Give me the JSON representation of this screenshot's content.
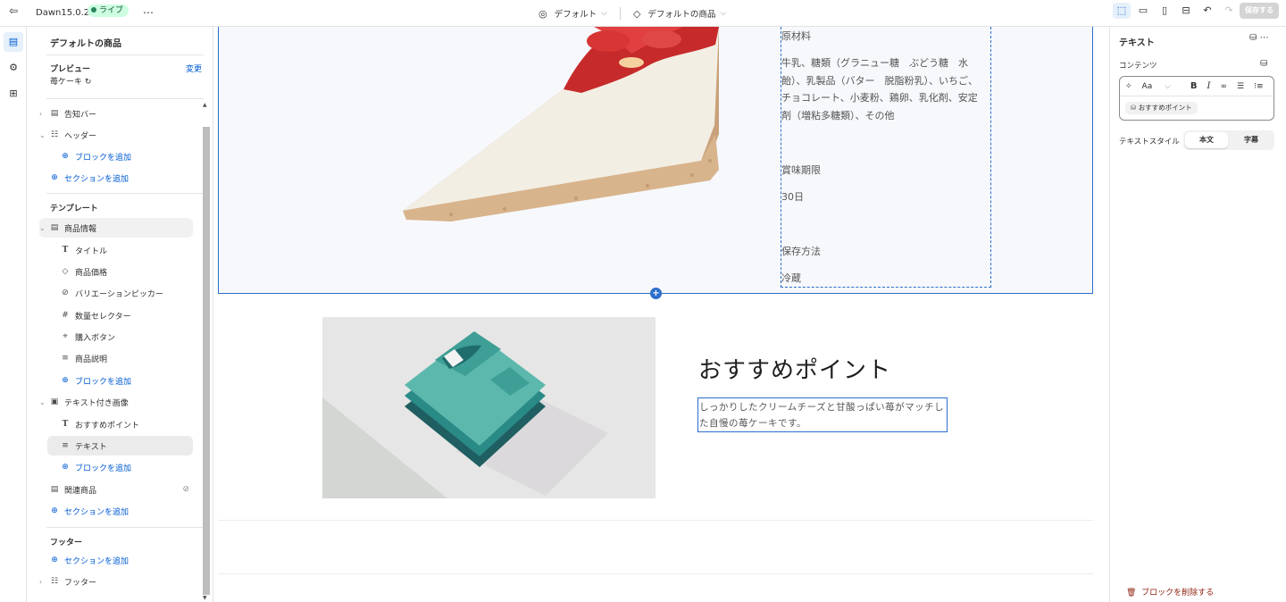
{
  "topbar": {
    "theme_name": "Dawn15.0.2",
    "live_badge": "ライブ",
    "more_label": "…",
    "theme_select": "デフォルト",
    "template_select": "デフォルトの商品",
    "save_label": "保存する"
  },
  "sidebar": {
    "title": "デフォルトの商品",
    "preview_label": "プレビュー",
    "preview_change": "変更",
    "preview_value": "苺ケーキ",
    "header_items": [
      {
        "label": "告知バー"
      },
      {
        "label": "ヘッダー"
      },
      {
        "label": "ブロックを追加"
      },
      {
        "label": "セクションを追加"
      }
    ],
    "template_heading": "テンプレート",
    "template_items": [
      {
        "label": "商品情報"
      },
      {
        "label": "タイトル"
      },
      {
        "label": "商品価格"
      },
      {
        "label": "バリエーションピッカー"
      },
      {
        "label": "数量セレクター"
      },
      {
        "label": "購入ボタン"
      },
      {
        "label": "商品説明"
      },
      {
        "label": "ブロックを追加"
      },
      {
        "label": "テキスト付き画像"
      },
      {
        "label": "おすすめポイント"
      },
      {
        "label": "テキスト"
      },
      {
        "label": "ブロックを追加"
      },
      {
        "label": "関連商品"
      },
      {
        "label": "セクションを追加"
      }
    ],
    "footer_heading": "フッター",
    "footer_items": [
      {
        "label": "セクションを追加"
      },
      {
        "label": "フッター"
      }
    ]
  },
  "canvas": {
    "ingredients_lines": [
      "原材料",
      "牛乳、糖類（グラニュー糖　ぶどう糖　水",
      "飴）、乳製品（バター　脱脂粉乳）、いちご、",
      "チョコレート、小麦粉、鶏卵、乳化剤、安定",
      "剤（増粘多糖類）、その他",
      "賞味期限",
      "30日",
      "保存方法",
      "冷蔵"
    ],
    "feature_heading": "おすすめポイント",
    "feature_text": "しっかりしたクリームチーズと甘酸っぱい苺がマッチした自慢の苺ケーキです。"
  },
  "panel": {
    "title": "テキスト",
    "content_label": "コンテンツ",
    "font_label": "Aa",
    "chip_label": "おすすめポイント",
    "text_style_label": "テキストスタイル",
    "style_options": [
      "本文",
      "字幕"
    ],
    "delete_label": "ブロックを削除する"
  },
  "colors": {
    "accent": "#005bd3",
    "selection_border": "#2c6ecb",
    "live_bg": "#cdfee1",
    "danger": "#8e1f0b"
  }
}
